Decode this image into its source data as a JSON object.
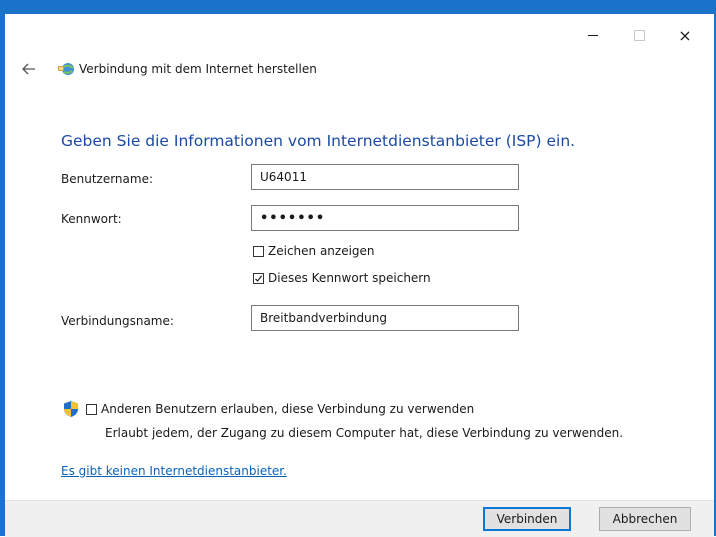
{
  "window": {
    "title": "Verbindung mit dem Internet herstellen",
    "controls": {
      "minimize": "minimize-icon",
      "maximize": "maximize-icon",
      "close": "×"
    },
    "accent_color": "#1a73c8"
  },
  "main": {
    "instruction": "Geben Sie die Informationen vom Internetdienstanbieter (ISP) ein.",
    "username": {
      "label": "Benutzername:",
      "value": "U64011"
    },
    "password": {
      "label": "Kennwort:",
      "value": "•••••••"
    },
    "show_chars": {
      "label": "Zeichen anzeigen",
      "checked": false
    },
    "save_password": {
      "label": "Dieses Kennwort speichern",
      "checked": true
    },
    "connection_name": {
      "label": "Verbindungsname:",
      "value": "Breitbandverbindung"
    },
    "allow_others": {
      "label": "Anderen Benutzern erlauben, diese Verbindung zu verwenden",
      "checked": false,
      "note": "Erlaubt jedem, der Zugang zu diesem Computer hat, diese Verbindung zu verwenden."
    },
    "no_isp_link": "Es gibt keinen Internetdienstanbieter."
  },
  "footer": {
    "connect_label": "Verbinden",
    "cancel_label": "Abbrechen"
  }
}
